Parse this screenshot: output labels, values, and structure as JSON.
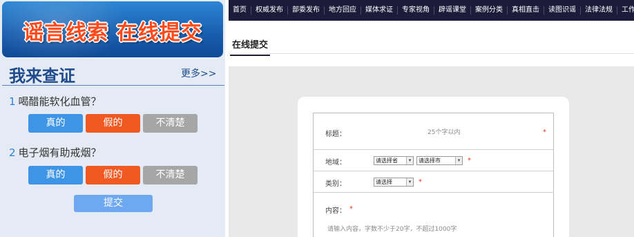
{
  "banner": {
    "title": "谣言线索 在线提交"
  },
  "check": {
    "title": "我来查证",
    "more": "更多>>",
    "questions": [
      {
        "num": "1",
        "text": "喝醋能软化血管？"
      },
      {
        "num": "2",
        "text": "电子烟有助戒烟？"
      }
    ],
    "answers": {
      "true": "真的",
      "false": "假的",
      "unknown": "不清楚"
    },
    "submit": "提交"
  },
  "nav": {
    "items": [
      "首页",
      "权威发布",
      "部委发布",
      "地方回应",
      "媒体求证",
      "专家视角",
      "辟谣课堂",
      "案例分类",
      "真相直击",
      "读图识谣",
      "法律法规",
      "工作动态"
    ]
  },
  "tab": {
    "active": "在线提交"
  },
  "form": {
    "title_label": "标题：",
    "title_placeholder": "25个字以内",
    "region_label": "地域：",
    "province_select": "请选择省",
    "city_select": "请选择市",
    "category_label": "类别：",
    "category_select": "请选择",
    "content_label": "内容：",
    "content_placeholder": "请输入内容，字数不少于20字，不超过1000字",
    "required_mark": "*"
  },
  "colors": {
    "nav_bg": "#1c1c3a",
    "true_btn": "#3f95e5",
    "false_btn": "#f05a22",
    "unknown_btn": "#a6a6a6",
    "submit_btn": "#6ea8f0",
    "heading": "#1f4b8c"
  }
}
